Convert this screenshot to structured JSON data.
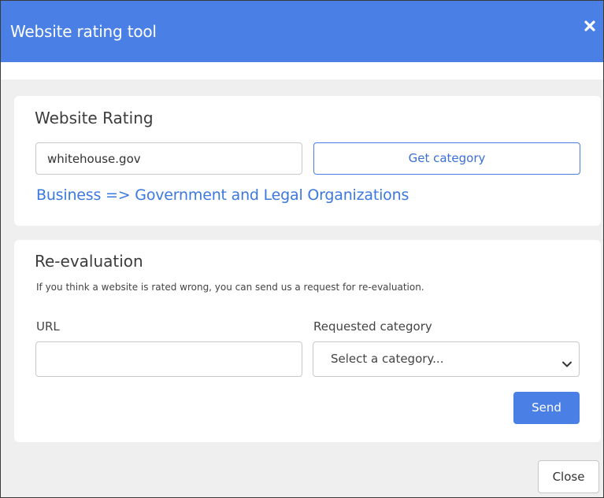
{
  "window": {
    "title": "Website rating tool",
    "close_icon": "close-icon"
  },
  "rating": {
    "heading": "Website Rating",
    "domain_value": "whitehouse.gov",
    "get_category_label": "Get category",
    "result": "Business => Government and Legal Organizations"
  },
  "reevaluation": {
    "heading": "Re-evaluation",
    "description": "If you think a website is rated wrong, you can send us a request for re-evaluation.",
    "url_label": "URL",
    "url_value": "",
    "category_label": "Requested category",
    "category_selected": "Select a category...",
    "send_label": "Send"
  },
  "footer": {
    "close_label": "Close"
  },
  "colors": {
    "accent": "#4a7fe6",
    "link": "#3b78e0",
    "background": "#efefef"
  }
}
